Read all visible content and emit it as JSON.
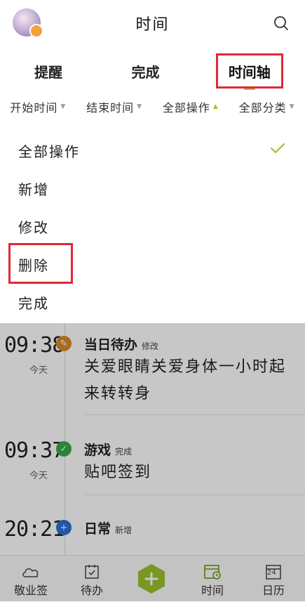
{
  "header": {
    "title": "时间",
    "search_icon": "search-icon",
    "avatar": "user-avatar"
  },
  "tabs": [
    {
      "label": "提醒",
      "active": false
    },
    {
      "label": "完成",
      "active": false
    },
    {
      "label": "时间轴",
      "active": true
    }
  ],
  "filters": [
    {
      "label": "开始时间",
      "open": false
    },
    {
      "label": "结束时间",
      "open": false
    },
    {
      "label": "全部操作",
      "open": true
    },
    {
      "label": "全部分类",
      "open": false
    }
  ],
  "dropdown": {
    "options": [
      {
        "label": "全部操作",
        "selected": true
      },
      {
        "label": "新增",
        "selected": false
      },
      {
        "label": "修改",
        "selected": false
      },
      {
        "label": "删除",
        "selected": false
      },
      {
        "label": "完成",
        "selected": false
      }
    ],
    "check_icon": "check-icon"
  },
  "timeline": [
    {
      "time": "09:38",
      "day": "今天",
      "category": "当日待办",
      "action": "修改",
      "content": "关爱眼睛关爱身体一小时起来转转身",
      "icon": "edit-icon",
      "color": "#d98a2b"
    },
    {
      "time": "09:37",
      "day": "今天",
      "category": "游戏",
      "action": "完成",
      "content": "贴吧签到",
      "icon": "check-circle-icon",
      "color": "#3aa84a"
    },
    {
      "time": "20:21",
      "day": "",
      "category": "日常",
      "action": "新增",
      "content": "",
      "icon": "plus-circle-icon",
      "color": "#2f6fd6"
    }
  ],
  "bottom_nav": {
    "items": [
      {
        "label": "敬业签",
        "icon": "cloud-note-icon"
      },
      {
        "label": "待办",
        "icon": "todo-check-icon"
      },
      {
        "label": "",
        "icon": "add-hexagon-icon"
      },
      {
        "label": "时间",
        "icon": "time-calendar-icon",
        "active": true
      },
      {
        "label": "日历",
        "icon": "calendar-icon",
        "day": "24"
      }
    ],
    "accent": "#9ac32c"
  },
  "colors": {
    "accent": "#9ac32c",
    "highlight_box": "#e0283a"
  }
}
